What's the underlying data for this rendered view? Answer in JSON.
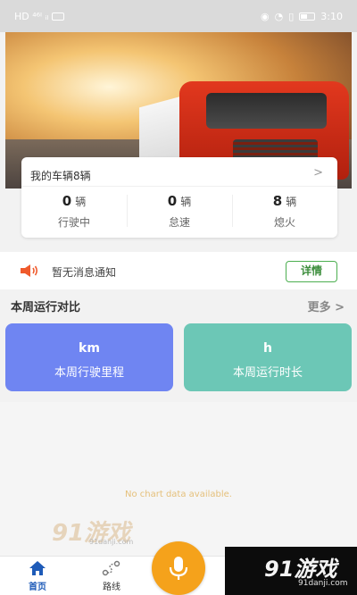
{
  "status_bar": {
    "left_text": "HD ⁴⁶ᴵ ᵢₗ",
    "time": "3:10"
  },
  "vehicle_card": {
    "title": "我的车辆8辆",
    "arrow": ">",
    "stats": [
      {
        "value": "0",
        "unit": "辆",
        "label": "行驶中"
      },
      {
        "value": "0",
        "unit": "辆",
        "label": "怠速"
      },
      {
        "value": "8",
        "unit": "辆",
        "label": "熄火"
      }
    ]
  },
  "notice": {
    "text": "暂无消息通知",
    "button_label": "详情"
  },
  "weekly": {
    "section_title": "本周运行对比",
    "more_label": "更多 >",
    "tiles": [
      {
        "value": "km",
        "label": "本周行驶里程",
        "color": "#6f85f2"
      },
      {
        "value": "h",
        "label": "本周运行时长",
        "color": "#6cc7b6"
      }
    ],
    "empty_text": "No chart data available."
  },
  "watermark": {
    "logo": "91游戏",
    "domain": "91danji.com"
  },
  "tabbar": {
    "tabs": [
      {
        "label": "首页",
        "icon": "home-icon",
        "active": true
      },
      {
        "label": "路线",
        "icon": "route-icon",
        "active": false
      }
    ],
    "mic_icon": "microphone-icon"
  },
  "colors": {
    "primary_blue": "#1e5bb8",
    "accent_orange": "#f5a21b",
    "detail_green": "#4caf50"
  }
}
